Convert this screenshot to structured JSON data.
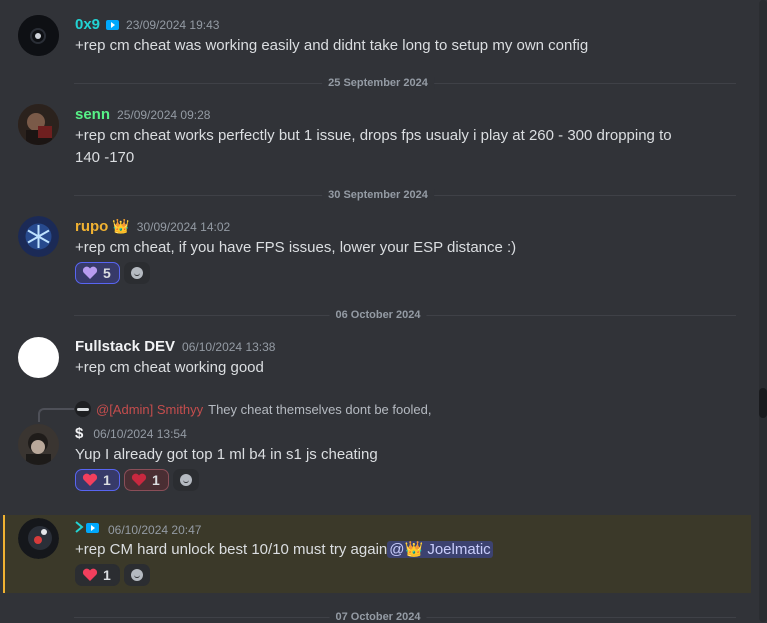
{
  "colors": {
    "bg": "#313338",
    "text": "#dbdee1",
    "muted": "#949ba4",
    "user_cyan": "#22d3d3",
    "user_green": "#57f287",
    "user_gold": "#f0b232",
    "user_red": "#c44d4d",
    "accent": "#5865f2"
  },
  "messages": [
    {
      "username": "0x9",
      "timestamp": "23/09/2024 19:43",
      "text": "+rep cm cheat was working easily and didnt take long to setup my own config",
      "badge": "video-badge-icon"
    },
    {
      "username": "senn",
      "timestamp": "25/09/2024 09:28",
      "text": "+rep cm cheat  works perfectly but 1 issue, drops fps usualy i play at 260 - 300 dropping to 140 -170"
    },
    {
      "username": "rupo",
      "crown": "👑",
      "timestamp": "30/09/2024 14:02",
      "text": "+rep cm cheat, if you have FPS issues, lower your ESP distance :)",
      "reactions": [
        {
          "emoji": "purple-heart",
          "count": "5"
        }
      ]
    },
    {
      "username": "Fullstack DEV",
      "timestamp": "06/10/2024 13:38",
      "text": "+rep cm cheat working good"
    },
    {
      "username": "$",
      "timestamp": "06/10/2024 13:54",
      "text": "Yup I already got top 1 ml b4 in s1 js cheating",
      "reply": {
        "username": "@[Admin] Smithyy",
        "text": "They cheat themselves dont be fooled,"
      },
      "reactions": [
        {
          "emoji": "red-heart",
          "count": "1"
        },
        {
          "emoji": "red-heart",
          "count": "1"
        }
      ]
    },
    {
      "username": "",
      "timestamp": "06/10/2024 20:47",
      "text": "+rep CM hard unlock best 10/10 must try again",
      "mention": "@👑 Joelmatic",
      "reactions": [
        {
          "emoji": "red-heart",
          "count": "1"
        }
      ]
    }
  ],
  "dividers": [
    "25 September 2024",
    "30 September 2024",
    "06 October 2024",
    "07 October 2024"
  ]
}
